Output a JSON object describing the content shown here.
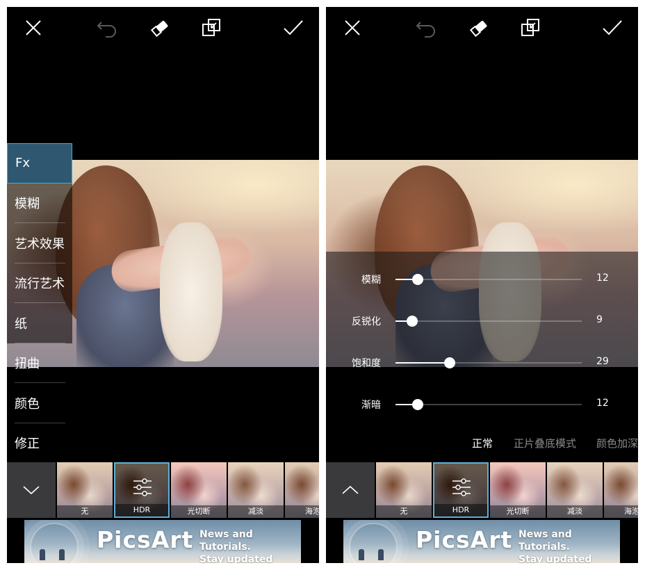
{
  "left": {
    "toolbar": {
      "close": "close-icon",
      "undo": "undo-icon",
      "eraser": "eraser-icon",
      "compare": "compare-icon",
      "apply": "check-icon"
    },
    "categories": [
      {
        "label": "Fx",
        "selected": true
      },
      {
        "label": "模糊",
        "selected": false
      },
      {
        "label": "艺术效果",
        "selected": false
      },
      {
        "label": "流行艺术",
        "selected": false
      },
      {
        "label": "纸",
        "selected": false
      },
      {
        "label": "扭曲",
        "selected": false
      },
      {
        "label": "颜色",
        "selected": false
      },
      {
        "label": "修正",
        "selected": false
      }
    ],
    "strip_toggle": "chevron-down-icon",
    "effects": [
      {
        "label": "无",
        "selected": false
      },
      {
        "label": "HDR",
        "selected": true
      },
      {
        "label": "光切断",
        "selected": false
      },
      {
        "label": "减淡",
        "selected": false
      },
      {
        "label": "海泡",
        "selected": false
      }
    ]
  },
  "right": {
    "toolbar": {
      "close": "close-icon",
      "undo": "undo-icon",
      "eraser": "eraser-icon",
      "compare": "compare-icon",
      "apply": "check-icon"
    },
    "sliders": [
      {
        "label": "模糊",
        "value": "12",
        "fraction": 0.12
      },
      {
        "label": "反锐化",
        "value": "9",
        "fraction": 0.09
      },
      {
        "label": "饱和度",
        "value": "29",
        "fraction": 0.29
      },
      {
        "label": "渐暗",
        "value": "12",
        "fraction": 0.12
      }
    ],
    "blend_modes": [
      {
        "label": "正常",
        "selected": true
      },
      {
        "label": "正片叠底模式",
        "selected": false
      },
      {
        "label": "颜色加深",
        "selected": false
      }
    ],
    "strip_toggle": "chevron-up-icon",
    "effects": [
      {
        "label": "无",
        "selected": false
      },
      {
        "label": "HDR",
        "selected": true
      },
      {
        "label": "光切断",
        "selected": false
      },
      {
        "label": "减淡",
        "selected": false
      },
      {
        "label": "海泡",
        "selected": false
      }
    ]
  },
  "ad": {
    "brand": "PicsArt",
    "tagline_1": "News and Tutorials.",
    "tagline_2": "Stay updated"
  },
  "colors": {
    "selected_border": "#4aa8d8",
    "selected_bg": "#2f5870",
    "toolbar_icon": "#ffffff",
    "undo_disabled": "#5a5a5a"
  }
}
